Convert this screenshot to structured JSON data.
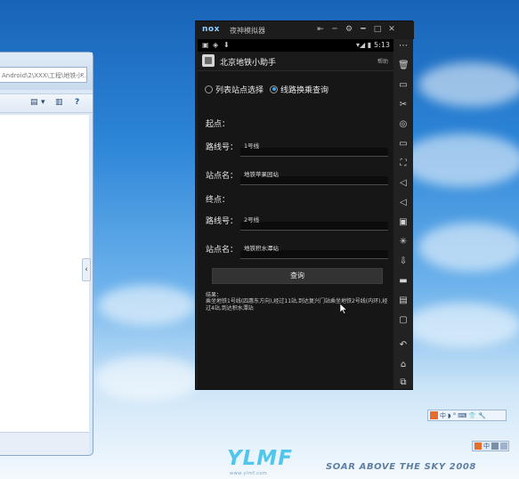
{
  "explorer": {
    "address_fragment": "Android\\2\\XXX\\工程\\地铁小…",
    "search_glyph": "⌕",
    "toolbar_view": "▤",
    "toolbar_drop": "▾",
    "toolbar_grid": "▥",
    "help_glyph": "?",
    "collapse_glyph": "‹"
  },
  "nox": {
    "logo": "nox",
    "title": "夜神模拟器",
    "controls": [
      "⇤",
      "─",
      "⚙",
      "━",
      "□",
      "✕"
    ],
    "status_icons": [
      "▣",
      "◈",
      "⬇"
    ],
    "status_right": "▾◢ ▮",
    "clock": "5:13",
    "app_title": "北京地铁小助手",
    "help": "帮助",
    "radio_options": [
      {
        "label": "列表站点选择",
        "selected": false
      },
      {
        "label": "线路换乘查询",
        "selected": true
      }
    ],
    "start_label": "起点：",
    "end_label": "终点：",
    "line_label": "路线号：",
    "station_label": "站点名：",
    "start_line": "1号线",
    "start_station": "地铁苹果园站",
    "end_line": "2号线",
    "end_station": "地铁积水潭站",
    "query_button": "查询",
    "result_heading": "结果：",
    "result_text": "乘坐地铁1号线(四惠东方向),经过11站,到达复兴门站乘坐地铁2号线(内环),经过4站,到达积水潭站",
    "sidebar": [
      "⋯",
      "🗑",
      "▭",
      "✂",
      "◎",
      "▭",
      "⛶",
      "◁",
      "◁",
      "▣",
      "✳",
      "⇩",
      "▬",
      "▤",
      "▢",
      "↶",
      "⌂",
      "⧉"
    ]
  },
  "tray": {
    "ime_chars": [
      "中",
      "◗",
      "°",
      "⌨",
      "👕",
      "🔧"
    ],
    "ime_label": "中"
  },
  "wallpaper": {
    "brand": "YLMF",
    "brand_sub": "www.ylmf.com",
    "tagline": "SOAR ABOVE THE SKY 2008"
  },
  "colors": {
    "accent": "#3aa4e8",
    "nox_bg": "#1e1e1e"
  }
}
